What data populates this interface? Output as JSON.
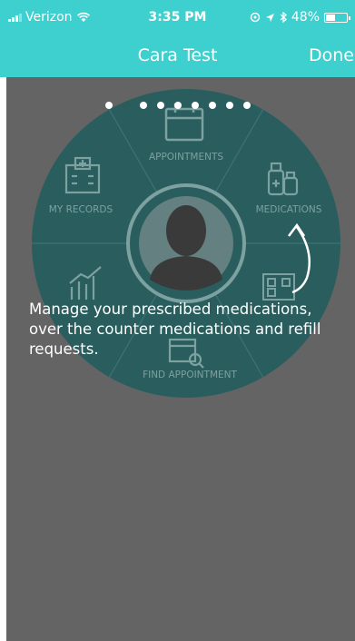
{
  "status_bar": {
    "carrier": "Verizon",
    "time": "3:35 PM",
    "battery": "48%",
    "battery_level": 0.48
  },
  "nav": {
    "title": "Cara Test",
    "done_label": "Done"
  },
  "wheel": {
    "segments": [
      {
        "label": "APPOINTMENTS",
        "icon": "calendar-icon"
      },
      {
        "label": "MEDICATIONS",
        "icon": "medication-bottles-icon"
      },
      {
        "label": "FIND APPOINTMENT",
        "icon": "calendar-search-icon"
      },
      {
        "label": "MY RECORDS",
        "icon": "hospital-building-icon"
      }
    ],
    "center_icon": "user-avatar-icon",
    "hidden_icons": [
      "bar-chart-icon",
      "qr-code-icon"
    ]
  },
  "pager": {
    "count": 9,
    "active_index": 2
  },
  "caption": "Manage your prescribed medications, over the counter medications and refill requests."
}
